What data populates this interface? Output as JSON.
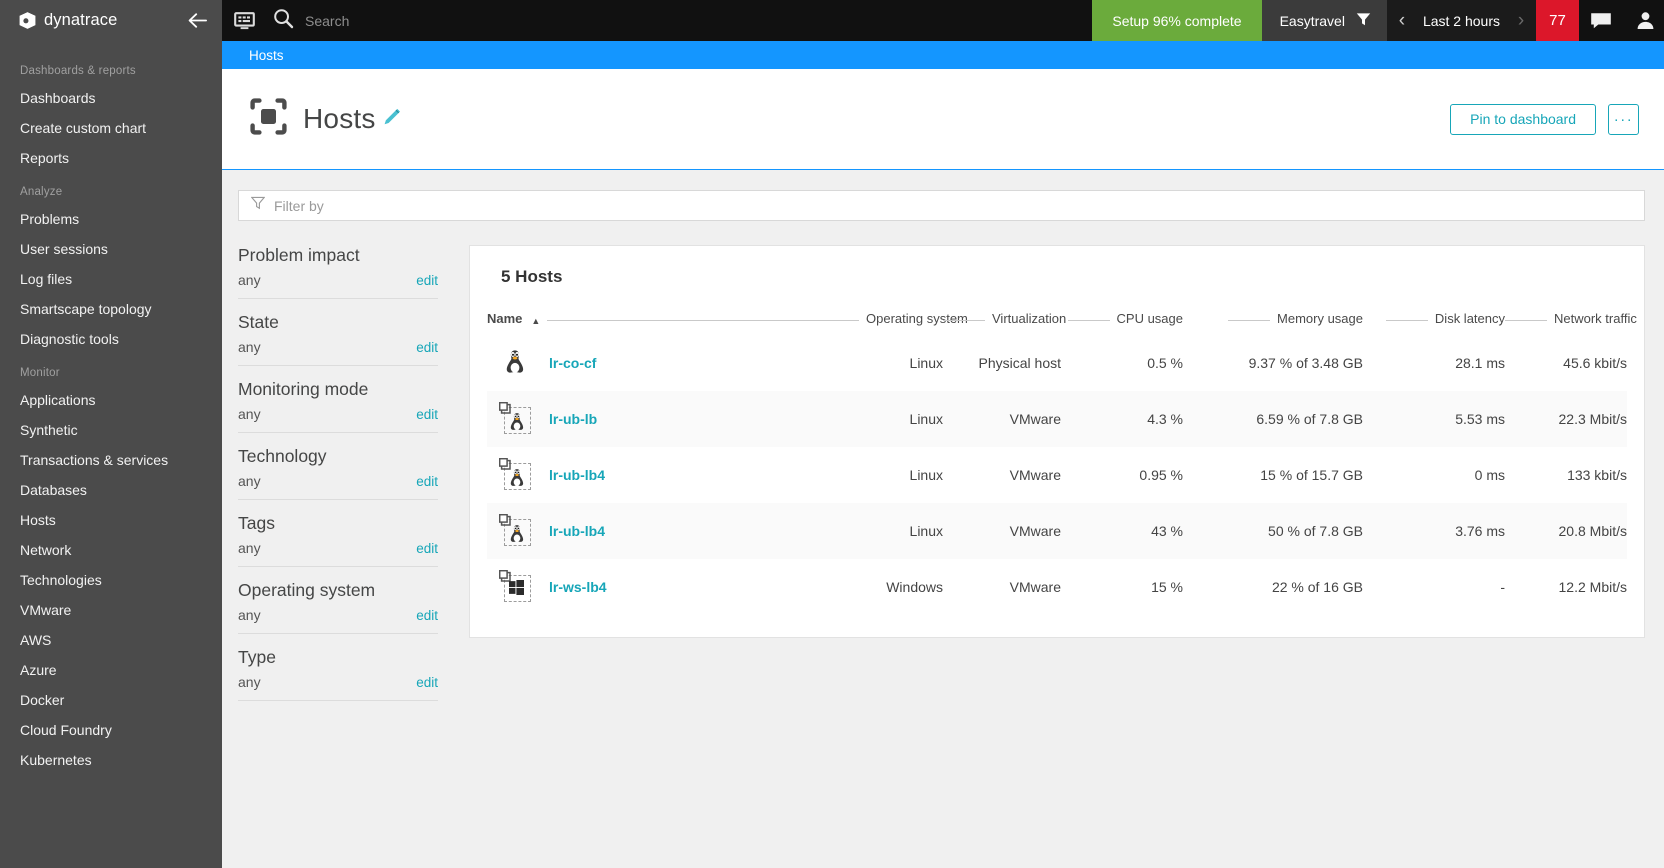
{
  "sidebar": {
    "brand": "dynatrace",
    "collapse_label": "collapse-navigation",
    "groups": [
      {
        "label": "Dashboards & reports",
        "items": [
          "Dashboards",
          "Create custom chart",
          "Reports"
        ]
      },
      {
        "label": "Analyze",
        "items": [
          "Problems",
          "User sessions",
          "Log files",
          "Smartscape topology",
          "Diagnostic tools"
        ]
      },
      {
        "label": "Monitor",
        "items": [
          "Applications",
          "Synthetic",
          "Transactions & services",
          "Databases",
          "Hosts",
          "Network",
          "Technologies",
          "VMware",
          "AWS",
          "Azure",
          "Docker",
          "Cloud Foundry",
          "Kubernetes"
        ]
      }
    ]
  },
  "topbar": {
    "monitor_icon": "monitor-icon",
    "search_icon": "search-icon",
    "search_placeholder": "Search",
    "setup_label": "Setup 96% complete",
    "setup_color": "#6bab3c",
    "management_zone": "Easytravel",
    "filter_icon": "funnel-icon",
    "time_prev": "‹",
    "time_label": "Last 2 hours",
    "time_next": "›",
    "problems_count": "77",
    "problems_color": "#dc172a",
    "chat_icon": "chat-icon",
    "user_icon": "user-icon"
  },
  "breadcrumb": {
    "items": [
      "Hosts"
    ],
    "bar_color": "#1496ff"
  },
  "page": {
    "icon": "hosts-icon",
    "title": "Hosts",
    "edit_icon": "pencil-icon",
    "pin_label": "Pin to dashboard",
    "more_label": "···",
    "accent": "#17a6b8"
  },
  "filter": {
    "icon": "funnel-icon",
    "placeholder": "Filter by",
    "value": ""
  },
  "facets": [
    {
      "title": "Problem impact",
      "value": "any",
      "edit": "edit"
    },
    {
      "title": "State",
      "value": "any",
      "edit": "edit"
    },
    {
      "title": "Monitoring mode",
      "value": "any",
      "edit": "edit"
    },
    {
      "title": "Technology",
      "value": "any",
      "edit": "edit"
    },
    {
      "title": "Tags",
      "value": "any",
      "edit": "edit"
    },
    {
      "title": "Operating system",
      "value": "any",
      "edit": "edit"
    },
    {
      "title": "Type",
      "value": "any",
      "edit": "edit"
    }
  ],
  "table": {
    "caption": "5 Hosts",
    "sort_column": "Name",
    "sort_direction": "asc",
    "columns": [
      "Name",
      "Operating system",
      "Virtualization",
      "CPU usage",
      "Memory usage",
      "Disk latency",
      "Network traffic"
    ],
    "rows": [
      {
        "icon": "linux-penguin-icon",
        "virtual": false,
        "name": "lr-co-cf",
        "os": "Linux",
        "virtualization": "Physical host",
        "cpu": "0.5 %",
        "memory": "9.37 % of 3.48 GB",
        "disk": "28.1 ms",
        "network": "45.6 kbit/s"
      },
      {
        "icon": "linux-penguin-icon",
        "virtual": true,
        "name": "lr-ub-lb",
        "os": "Linux",
        "virtualization": "VMware",
        "cpu": "4.3 %",
        "memory": "6.59 % of 7.8 GB",
        "disk": "5.53 ms",
        "network": "22.3 Mbit/s"
      },
      {
        "icon": "linux-penguin-icon",
        "virtual": true,
        "name": "lr-ub-lb4",
        "os": "Linux",
        "virtualization": "VMware",
        "cpu": "0.95 %",
        "memory": "15 % of 15.7 GB",
        "disk": "0 ms",
        "network": "133 kbit/s"
      },
      {
        "icon": "linux-penguin-icon",
        "virtual": true,
        "name": "lr-ub-lb4",
        "os": "Linux",
        "virtualization": "VMware",
        "cpu": "43 %",
        "memory": "50 % of 7.8 GB",
        "disk": "3.76 ms",
        "network": "20.8 Mbit/s"
      },
      {
        "icon": "windows-icon",
        "virtual": true,
        "name": "lr-ws-lb4",
        "os": "Windows",
        "virtualization": "VMware",
        "cpu": "15 %",
        "memory": "22 % of 16 GB",
        "disk": "-",
        "network": "12.2 Mbit/s"
      }
    ]
  }
}
